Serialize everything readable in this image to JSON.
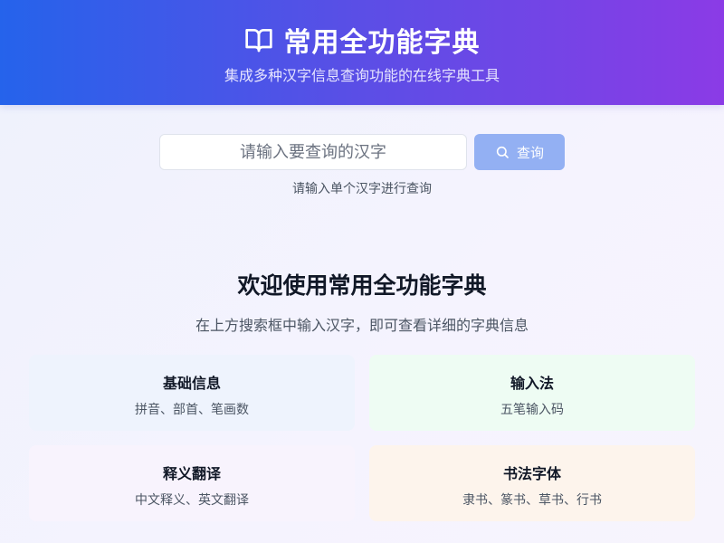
{
  "header": {
    "title": "常用全功能字典",
    "subtitle": "集成多种汉字信息查询功能的在线字典工具",
    "icon": "book-open-icon"
  },
  "search": {
    "placeholder": "请输入要查询的汉字",
    "value": "",
    "button_label": "查询",
    "button_icon": "search-icon",
    "hint": "请输入单个汉字进行查询"
  },
  "welcome": {
    "title": "欢迎使用常用全功能字典",
    "subtitle": "在上方搜索框中输入汉字，即可查看详细的字典信息"
  },
  "features": [
    {
      "title": "基础信息",
      "description": "拼音、部首、笔画数",
      "color": "#eef3fd"
    },
    {
      "title": "输入法",
      "description": "五笔输入码",
      "color": "#eefcf3"
    },
    {
      "title": "释义翻译",
      "description": "中文释义、英文翻译",
      "color": "#f8f3fd"
    },
    {
      "title": "书法字体",
      "description": "隶书、篆书、草书、行书",
      "color": "#fdf4ec"
    }
  ],
  "colors": {
    "header_gradient_start": "#2563eb",
    "header_gradient_end": "#8b3be6",
    "button_bg": "#93b0f3"
  }
}
